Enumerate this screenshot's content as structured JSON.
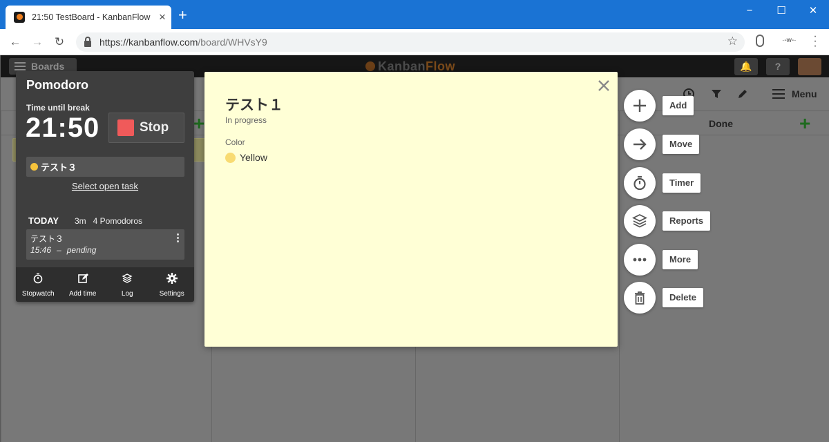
{
  "browser": {
    "tab_title": "21:50 TestBoard - KanbanFlow",
    "tab_close": "×",
    "new_tab": "+",
    "url_host": "https://kanbanflow.com",
    "url_path": "/board/WHVsY9",
    "ext_label": "·-w-·",
    "window_controls": {
      "minimize": "−",
      "maximize": "☐",
      "close": "✕"
    }
  },
  "app": {
    "boards_label": "Boards",
    "brand_left": "Kanban",
    "brand_right": "Flow",
    "help_label": "?",
    "menu_label": "Menu",
    "column_done_title": "Done"
  },
  "pomodoro": {
    "title": "Pomodoro",
    "time_until_break_label": "Time until break",
    "time": "21:50",
    "stop_label": "Stop",
    "current_task": "テスト３",
    "select_open_task": "Select open task",
    "today_label": "TODAY",
    "today_minutes": "3m",
    "today_pomodoros": "4 Pomodoros",
    "log_entry": {
      "task": "テスト３",
      "time": "15:46",
      "dash": "–",
      "status": "pending"
    },
    "footer": [
      {
        "label": "Stopwatch",
        "icon": "stopwatch-icon"
      },
      {
        "label": "Add time",
        "icon": "edit-icon"
      },
      {
        "label": "Log",
        "icon": "layers-icon"
      },
      {
        "label": "Settings",
        "icon": "gear-icon"
      }
    ]
  },
  "dialog": {
    "title": "テスト１",
    "status": "In progress",
    "color_label": "Color",
    "color_value": "Yellow",
    "color_hex": "#f8db72"
  },
  "actions": [
    {
      "label": "Add",
      "icon": "plus-icon"
    },
    {
      "label": "Move",
      "icon": "arrow-right-icon"
    },
    {
      "label": "Timer",
      "icon": "timer-icon"
    },
    {
      "label": "Reports",
      "icon": "layers-icon"
    },
    {
      "label": "More",
      "icon": "more-icon"
    },
    {
      "label": "Delete",
      "icon": "trash-icon"
    }
  ]
}
